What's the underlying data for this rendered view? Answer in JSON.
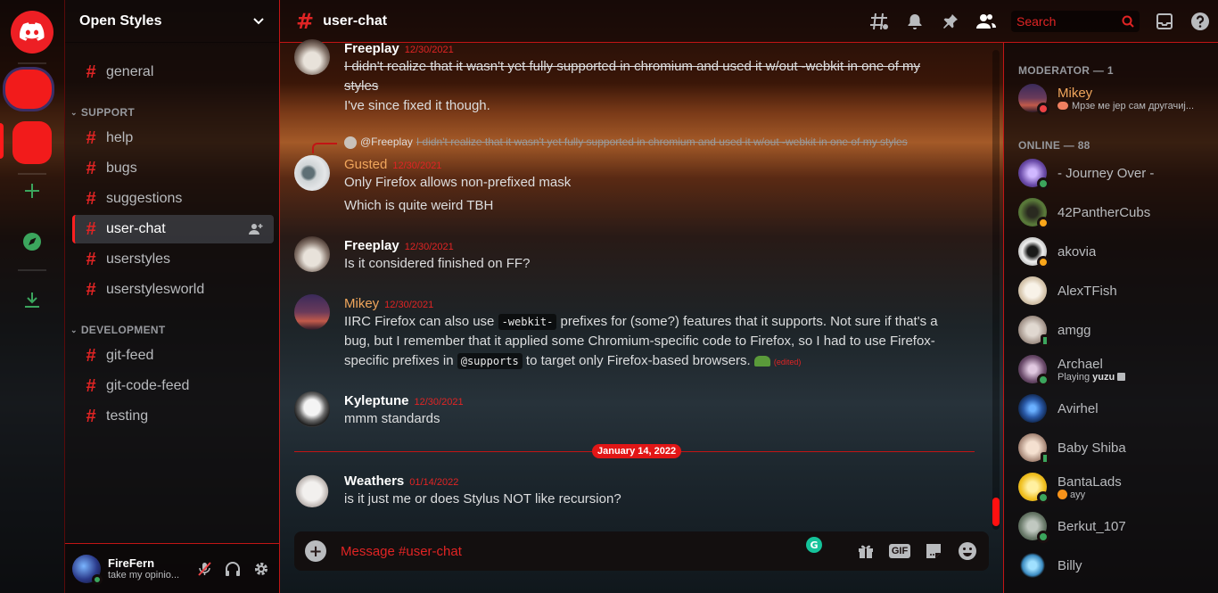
{
  "server": {
    "name": "Open Styles",
    "categories": [
      "SUPPORT",
      "DEVELOPMENT"
    ],
    "channels": [
      {
        "label": "general"
      },
      {
        "label": "help"
      },
      {
        "label": "bugs"
      },
      {
        "label": "suggestions"
      },
      {
        "label": "user-chat"
      },
      {
        "label": "userstyles"
      },
      {
        "label": "userstylesworld"
      },
      {
        "label": "git-feed"
      },
      {
        "label": "git-code-feed"
      },
      {
        "label": "testing"
      }
    ]
  },
  "user": {
    "name": "FireFern",
    "status": "take my opinio..."
  },
  "chat": {
    "channel": "user-chat",
    "search_placeholder": "Search",
    "composer_placeholder": "Message #user-chat",
    "gif_label": "GIF",
    "date_divider": "January 14, 2022",
    "reply": {
      "name": "@Freeplay",
      "text": "I didn't realize that it wasn't yet fully supported in chromium and used it w/out -webkit in one of my styles"
    },
    "messages": [
      {
        "author": "Freeplay",
        "time": "12/30/2021",
        "line1": "I didn't realize that it wasn't yet fully supported in chromium and used it w/out -webkit in one of my styles",
        "line2": "I've since fixed it though."
      },
      {
        "author": "Gusted",
        "time": "12/30/2021",
        "line1": "Only Firefox allows non-prefixed mask",
        "line2": "Which is quite weird TBH"
      },
      {
        "author": "Freeplay",
        "time": "12/30/2021",
        "line1": "Is it considered finished on FF?"
      },
      {
        "author": "Mikey",
        "time": "12/30/2021",
        "p1": "IIRC Firefox can also use ",
        "code1": "-webkit-",
        "p2": " prefixes for (some?) features that it supports. Not sure if that's a bug, but I remember that it applied some Chromium-specific code to Firefox, so I had to use Firefox-specific prefixes in ",
        "code2": "@supports",
        "p3": " to target only Firefox-based browsers. ",
        "edited": "(edited)"
      },
      {
        "author": "Kyleptune",
        "time": "12/30/2021",
        "line1": "mmm standards"
      },
      {
        "author": "Weathers",
        "time": "01/14/2022",
        "line1": "is it just me or does Stylus NOT like recursion?"
      }
    ]
  },
  "members": {
    "groups": [
      "MODERATOR — 1",
      "ONLINE — 88"
    ],
    "list": [
      {
        "name": "Mikey",
        "sub": "Мрзе ме јер сам другачиј..."
      },
      {
        "name": "- Journey Over -"
      },
      {
        "name": "42PantherCubs"
      },
      {
        "name": "akovia"
      },
      {
        "name": "AlexTFish"
      },
      {
        "name": "amgg"
      },
      {
        "name": "Archael",
        "sub_prefix": "Playing ",
        "sub_bold": "yuzu"
      },
      {
        "name": "Avirhel"
      },
      {
        "name": "Baby Shiba"
      },
      {
        "name": "BantaLads",
        "sub": "ayy"
      },
      {
        "name": "Berkut_107"
      },
      {
        "name": "Billy"
      }
    ]
  },
  "colors": {
    "accent": "#e02424",
    "mention": "#f0a65c",
    "online": "#3ba55d",
    "idle": "#faa61a",
    "dnd": "#ed4245"
  }
}
